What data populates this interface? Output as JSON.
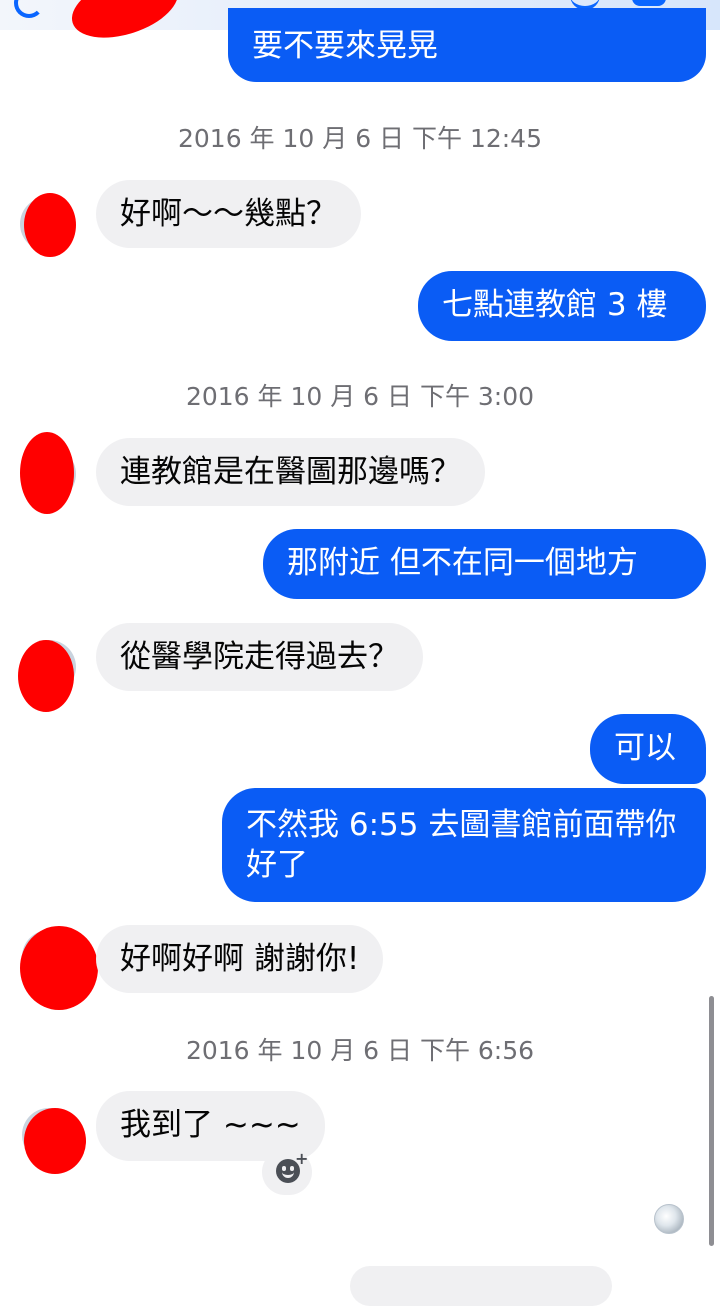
{
  "messages": {
    "m0": "要不要來晃晃",
    "ts1": "2016 年 10 月 6 日 下午 12:45",
    "m1": "好啊～～幾點？",
    "m2": "七點連教館 3 樓",
    "ts2": "2016 年 10 月 6 日 下午 3:00",
    "m3": "連教館是在醫圖那邊嗎？",
    "m4": "那附近 但不在同一個地方",
    "m5": "從醫學院走得過去？",
    "m6": "可以",
    "m7": "不然我 6:55 去圖書館前面帶你好了",
    "m8": "好啊好啊 謝謝你!",
    "ts3": "2016 年 10 月 6 日 下午 6:56",
    "m9": "我到了 ~~~"
  },
  "icons": {
    "top_left": "back-icon",
    "reaction": "add-reaction-icon",
    "seen": "read-receipt-avatar"
  },
  "colors": {
    "outgoing_bubble": "#0a5cf5",
    "incoming_bubble": "#f0f0f2",
    "redaction": "#ff0000",
    "timestamp_text": "#6e6e73"
  }
}
